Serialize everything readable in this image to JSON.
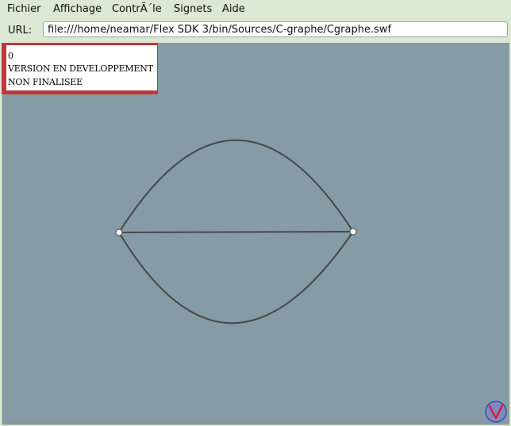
{
  "menu": {
    "items": [
      "Fichier",
      "Affichage",
      "ContrÃ´le",
      "Signets",
      "Aide"
    ]
  },
  "urlbar": {
    "label": "URL:",
    "value": "file:///home/neamar/Flex SDK 3/bin/Sources/C-graphe/Cgraphe.swf"
  },
  "dev_notice": {
    "line1": "0",
    "line2": "VERSION EN DEVELOPPEMENT",
    "line3": "NON FINALISEE"
  },
  "graph": {
    "nodes": [
      "node-left",
      "node-right"
    ],
    "edges": [
      "edge-upper-arc",
      "edge-straight",
      "edge-lower-arc"
    ]
  },
  "colors": {
    "canvas": "#859ca6",
    "edge": "#474747",
    "node_fill": "#ffffff",
    "notice_border": "#c0363b",
    "logo_fill": "#3f4f9a",
    "logo_v": "#e0151b"
  },
  "icons": {
    "logo": "v-logo-icon"
  }
}
